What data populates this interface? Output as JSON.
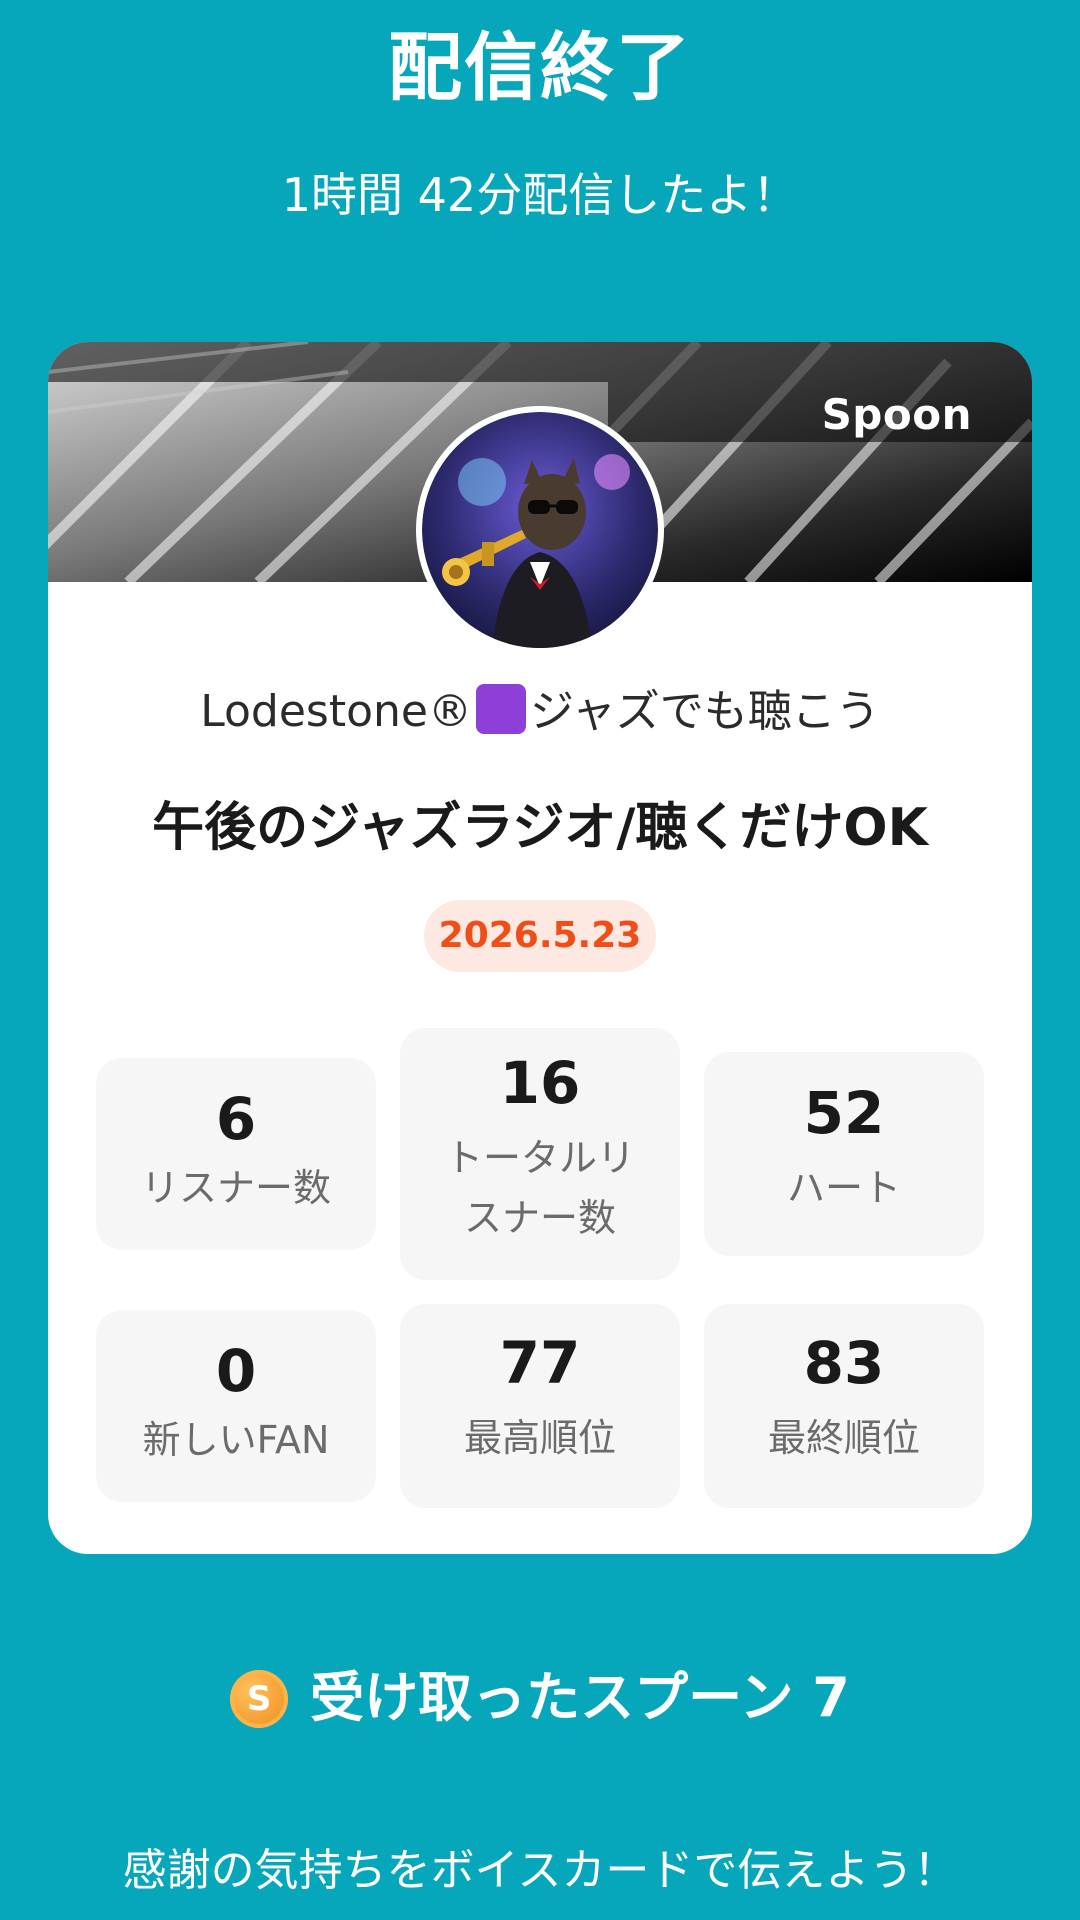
{
  "header": {
    "title": "配信終了",
    "duration_text": "1時間 42分配信したよ！"
  },
  "card": {
    "brand": "Spoon",
    "host_name_prefix": "Lodestone®",
    "host_name_suffix": "ジャズでも聴こう",
    "stream_title": "午後のジャズラジオ/聴くだけOK",
    "date": "2026.5.23"
  },
  "stats": [
    {
      "value": "6",
      "label": "リスナー数"
    },
    {
      "value": "16",
      "label_line1": "トータルリ",
      "label_line2": "スナー数"
    },
    {
      "value": "52",
      "label": "ハート"
    },
    {
      "value": "0",
      "label": "新しいFAN"
    },
    {
      "value": "77",
      "label": "最高順位"
    },
    {
      "value": "83",
      "label": "最終順位"
    }
  ],
  "spoons": {
    "coin_letter": "S",
    "text": "受け取ったスプーン 7"
  },
  "footer": {
    "thanks_text": "感謝の気持ちをボイスカードで伝えよう！"
  },
  "colors": {
    "background": "#07a7bb",
    "date_text": "#f04e16",
    "date_bg": "#fde9e2",
    "host_icon_square": "#8d3fd8"
  },
  "icons": {
    "coin": "spoon-coin-icon",
    "avatar": "cat-trumpet-avatar"
  }
}
